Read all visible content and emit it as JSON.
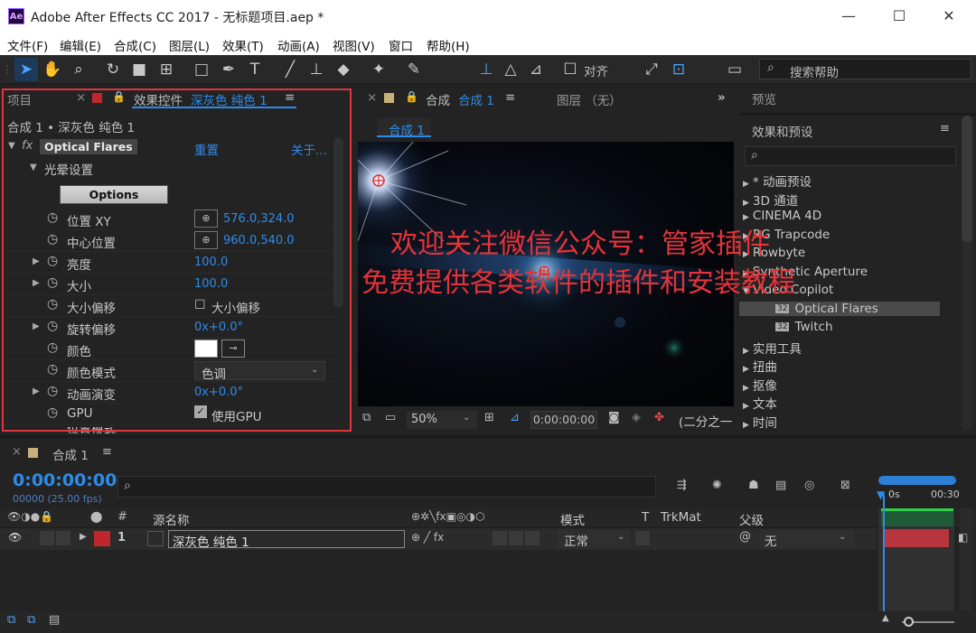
{
  "window": {
    "title": "Adobe After Effects CC 2017 - 无标题项目.aep *",
    "logo": "Ae"
  },
  "menu": [
    "文件(F)",
    "编辑(E)",
    "合成(C)",
    "图层(L)",
    "效果(T)",
    "动画(A)",
    "视图(V)",
    "窗口",
    "帮助(H)"
  ],
  "toolbar": {
    "align_label": "对齐",
    "search_placeholder": "搜索帮助"
  },
  "project_tab": "项目",
  "effect_controls": {
    "tab_label": "效果控件",
    "tab_layer": "深灰色 纯色 1",
    "breadcrumb": "合成 1 • 深灰色 纯色 1",
    "effect_name": "Optical Flares",
    "reset_label": "重置",
    "about_label": "关于...",
    "group_label": "光晕设置",
    "options_button": "Options",
    "properties": [
      {
        "name": "位置 XY",
        "value": "576.0,324.0",
        "type": "point"
      },
      {
        "name": "中心位置",
        "value": "960.0,540.0",
        "type": "point"
      },
      {
        "name": "亮度",
        "value": "100.0",
        "type": "value"
      },
      {
        "name": "大小",
        "value": "100.0",
        "type": "value"
      },
      {
        "name": "大小偏移",
        "value": "大小偏移",
        "type": "checkbox"
      },
      {
        "name": "旋转偏移",
        "value": "0x+0.0°",
        "type": "value"
      },
      {
        "name": "颜色",
        "value": "",
        "type": "color"
      },
      {
        "name": "颜色模式",
        "value": "色调",
        "type": "select"
      },
      {
        "name": "动画演变",
        "value": "0x+0.0°",
        "type": "value"
      },
      {
        "name": "GPU",
        "value": "使用GPU",
        "type": "checkbox"
      }
    ],
    "cut_row": "位置模式"
  },
  "composition": {
    "tab_label": "合成",
    "tab_name": "合成 1",
    "layer_tab": "图层 （无）",
    "sub_tab": "合成 1",
    "zoom": "50%",
    "timecode": "0:00:00:00",
    "resolution": "(二分之一)"
  },
  "watermark": {
    "line1": "欢迎关注微信公众号：管家插件",
    "line2": "免费提供各类软件的插件和安装教程"
  },
  "right_panels": {
    "preview_label": "预览",
    "effects_label": "效果和预设",
    "search_placeholder": "",
    "tree": [
      {
        "label": "* 动画预设",
        "indent": 0,
        "expanded": false
      },
      {
        "label": "3D 通道",
        "indent": 0,
        "expanded": false
      },
      {
        "label": "CINEMA 4D",
        "indent": 0,
        "expanded": false
      },
      {
        "label": "RG Trapcode",
        "indent": 0,
        "expanded": false
      },
      {
        "label": "Rowbyte",
        "indent": 0,
        "expanded": false
      },
      {
        "label": "Synthetic Aperture",
        "indent": 0,
        "expanded": false
      },
      {
        "label": "Video Copilot",
        "indent": 0,
        "expanded": true
      },
      {
        "label": "Optical Flares",
        "indent": 1,
        "selected": true
      },
      {
        "label": "Twitch",
        "indent": 1
      },
      {
        "label": "实用工具",
        "indent": 0,
        "expanded": false
      },
      {
        "label": "扭曲",
        "indent": 0,
        "expanded": false
      },
      {
        "label": "抠像",
        "indent": 0,
        "expanded": false
      },
      {
        "label": "文本",
        "indent": 0,
        "expanded": false
      },
      {
        "label": "时间",
        "indent": 0,
        "expanded": false
      }
    ]
  },
  "timeline": {
    "tab": "合成 1",
    "timecode": "0:00:00:00",
    "frames": "00000 (25.00 fps)",
    "columns": {
      "source_name": "源名称",
      "mode": "模式",
      "t": "T",
      "trkmat": "TrkMat",
      "parent": "父级"
    },
    "ruler": [
      "0s",
      "00:30"
    ],
    "layer": {
      "index": "1",
      "name": "深灰色 纯色 1",
      "mode": "正常",
      "parent": "无",
      "color": "#c0272d"
    }
  },
  "colors": {
    "accent": "#2d8ceb",
    "highlight_border": "#e0353f",
    "watermark": "#e5333a"
  }
}
